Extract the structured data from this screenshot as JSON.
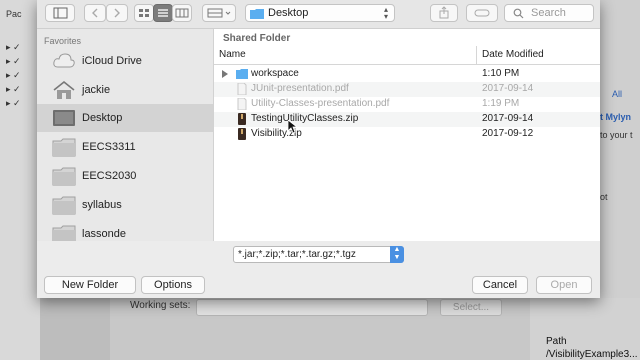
{
  "toolbar": {
    "location": "Desktop",
    "search_placeholder": "Search"
  },
  "sidebar": {
    "section_title": "Favorites",
    "items": [
      {
        "label": "iCloud Drive",
        "icon": "cloud-icon"
      },
      {
        "label": "jackie",
        "icon": "home-icon"
      },
      {
        "label": "Desktop",
        "icon": "desktop-icon",
        "selected": true
      },
      {
        "label": "EECS3311",
        "icon": "folder-icon"
      },
      {
        "label": "EECS2030",
        "icon": "folder-icon"
      },
      {
        "label": "syllabus",
        "icon": "folder-icon"
      },
      {
        "label": "lassonde",
        "icon": "folder-icon"
      }
    ]
  },
  "main": {
    "section_title": "Shared Folder",
    "col_name": "Name",
    "col_date": "Date Modified",
    "files": [
      {
        "name": "workspace",
        "date": "1:10 PM",
        "kind": "folder",
        "enabled": true
      },
      {
        "name": "JUnit-presentation.pdf",
        "date": "2017-09-14",
        "kind": "pdf",
        "enabled": false
      },
      {
        "name": "Utility-Classes-presentation.pdf",
        "date": "1:19 PM",
        "kind": "pdf",
        "enabled": false
      },
      {
        "name": "TestingUtilityClasses.zip",
        "date": "2017-09-14",
        "kind": "zip",
        "enabled": true
      },
      {
        "name": "Visibility.zip",
        "date": "2017-09-12",
        "kind": "zip",
        "enabled": true
      }
    ]
  },
  "filter": "*.jar;*.zip;*.tar;*.tar.gz;*.tgz",
  "buttons": {
    "new_folder": "New Folder",
    "options": "Options",
    "cancel": "Cancel",
    "open": "Open"
  },
  "background": {
    "pac_tab": "Pac",
    "working_sets_label": "Working sets:",
    "select_button": "Select...",
    "right_all": "All",
    "right_mylyn": "t Mylyn",
    "right_to_your": "to your t",
    "right_ot": "ot",
    "path_header": "Path",
    "path_value": "/VisibilityExample3..."
  },
  "colors": {
    "accent": "#4a90e2",
    "folder_blue": "#5aaef0",
    "zip_dark": "#3a2a22"
  }
}
